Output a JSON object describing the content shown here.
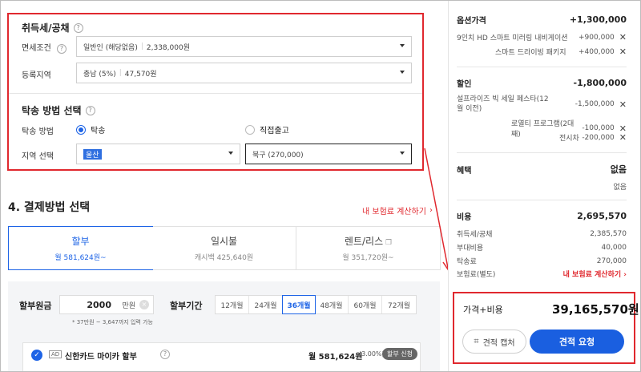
{
  "tax": {
    "title": "취득세/공채",
    "exemption_label": "면세조건",
    "exemption_value": "일반인 (해당없음)",
    "exemption_amount": "2,338,000원",
    "region_label": "등록지역",
    "region_value": "충남 (5%)",
    "region_amount": "47,570원"
  },
  "delivery": {
    "title": "탁송 방법 선택",
    "method_label": "탁송 방법",
    "option_delivery": "탁송",
    "option_pickup": "직접출고",
    "area_label": "지역 선택",
    "area_city": "울산",
    "area_district": "북구 (270,000)"
  },
  "payment": {
    "step_title": "4. 결제방법 선택",
    "insurance_link": "내 보험료 계산하기",
    "tabs": [
      {
        "label": "할부",
        "sub": "월 581,624원~"
      },
      {
        "label": "일시불",
        "sub": "캐시백 425,640원"
      },
      {
        "label": "렌트/리스",
        "sub": "월 351,720원~"
      }
    ],
    "principal_label": "할부원금",
    "principal_value": "2000",
    "principal_unit": "만원",
    "principal_hint": "* 37만원 ~ 3,647까지 입력 가능",
    "period_label": "할부기간",
    "periods": [
      "12개월",
      "24개월",
      "36개월",
      "48개월",
      "60개월",
      "72개월"
    ],
    "card_ad": "AD",
    "card_name": "신한카드 마이카 할부",
    "card_amount": "월 581,624원",
    "card_rate": "(3.00%)",
    "card_apply": "할부 신청"
  },
  "summary": {
    "options_label": "옵션가격",
    "options_total": "+1,300,000",
    "options": [
      {
        "name": "9인치 HD 스마트 미러링 내비게이션",
        "price": "+900,000"
      },
      {
        "name": "스마트 드라이빙 패키지",
        "price": "+400,000"
      }
    ],
    "discount_label": "할인",
    "discount_total": "-1,800,000",
    "discounts": [
      {
        "name": "설프라이즈 빅 세일 페스타(12월 이전)",
        "price": "-1,500,000"
      },
      {
        "name": "로열티 프로그램(2대째)",
        "price": "-100,000"
      },
      {
        "name": "전시차",
        "price": "-200,000"
      }
    ],
    "benefit_label": "혜택",
    "benefit_value": "없음",
    "benefit_sub": "없음",
    "cost_label": "비용",
    "cost_total": "2,695,570",
    "costs": [
      {
        "name": "취득세/공채",
        "price": "2,385,570"
      },
      {
        "name": "부대비용",
        "price": "40,000"
      },
      {
        "name": "탁송료",
        "price": "270,000"
      }
    ],
    "insurance_label": "보험료(별도)",
    "insurance_link": "내 보험료 계산하기",
    "total_label": "가격+비용",
    "total_value": "39,165,570원",
    "capture_button": "견적 캡처",
    "request_button": "견적 요청"
  },
  "colors": {
    "accent": "#1e64e6",
    "highlight": "#e0282e"
  }
}
